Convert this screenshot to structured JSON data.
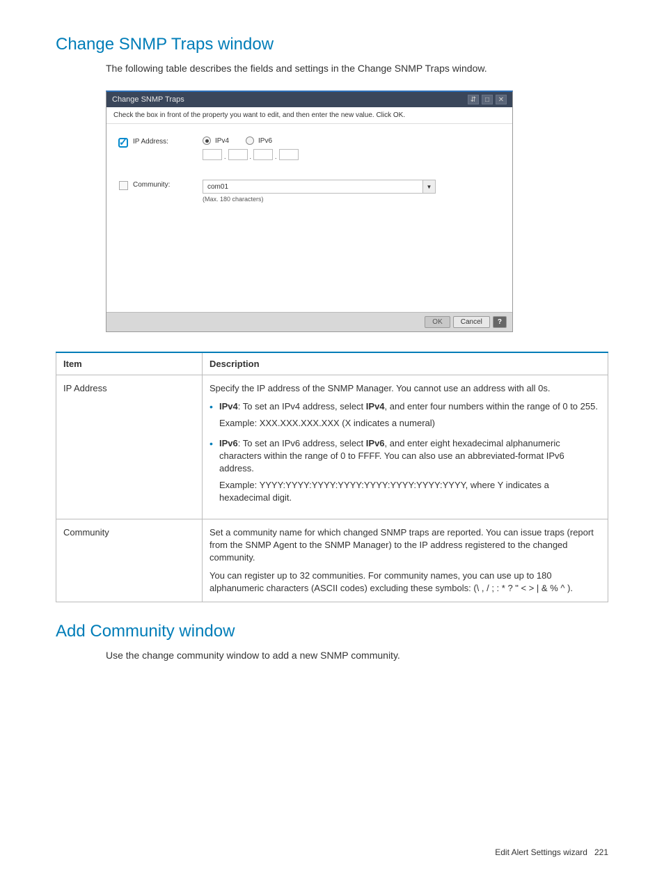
{
  "section1": {
    "heading": "Change SNMP Traps window",
    "intro": "The following table describes the fields and settings in the Change SNMP Traps window."
  },
  "dialog": {
    "title": "Change SNMP Traps",
    "instruction": "Check the box in front of the property you want to edit, and then enter the new value. Click OK.",
    "ip_label": "IP Address:",
    "ipv4_label": "IPv4",
    "ipv6_label": "IPv6",
    "community_label": "Community:",
    "community_value": "com01",
    "community_hint": "(Max. 180 characters)",
    "ok": "OK",
    "cancel": "Cancel",
    "help": "?"
  },
  "table": {
    "head_item": "Item",
    "head_desc": "Description",
    "row1": {
      "item": "IP Address",
      "p1": "Specify the IP address of the SNMP Manager. You cannot use an address with all 0s.",
      "b1_bold1": "IPv4",
      "b1_t1": ": To set an IPv4 address, select ",
      "b1_bold2": "IPv4",
      "b1_t2": ", and enter four numbers within the range of 0 to 255.",
      "b1_ex": "Example: XXX.XXX.XXX.XXX (X indicates a numeral)",
      "b2_bold1": "IPv6",
      "b2_t1": ": To set an IPv6 address, select ",
      "b2_bold2": "IPv6",
      "b2_t2": ", and enter eight hexadecimal alphanumeric characters within the range of 0 to FFFF. You can also use an abbreviated-format IPv6 address.",
      "b2_ex": "Example: YYYY:YYYY:YYYY:YYYY:YYYY:YYYY:YYYY:YYYY, where Y indicates a hexadecimal digit."
    },
    "row2": {
      "item": "Community",
      "p1": "Set a community name for which changed SNMP traps are reported. You can issue traps (report from the SNMP Agent to the SNMP Manager) to the IP address registered to the changed community.",
      "p2": "You can register up to 32 communities. For community names, you can use up to 180 alphanumeric characters (ASCII codes) excluding these symbols: (\\ , / ; : * ? \" < > | & % ^ )."
    }
  },
  "section2": {
    "heading": "Add Community window",
    "intro": "Use the change community window to add a new SNMP community."
  },
  "footer": {
    "label": "Edit Alert Settings wizard",
    "page": "221"
  }
}
